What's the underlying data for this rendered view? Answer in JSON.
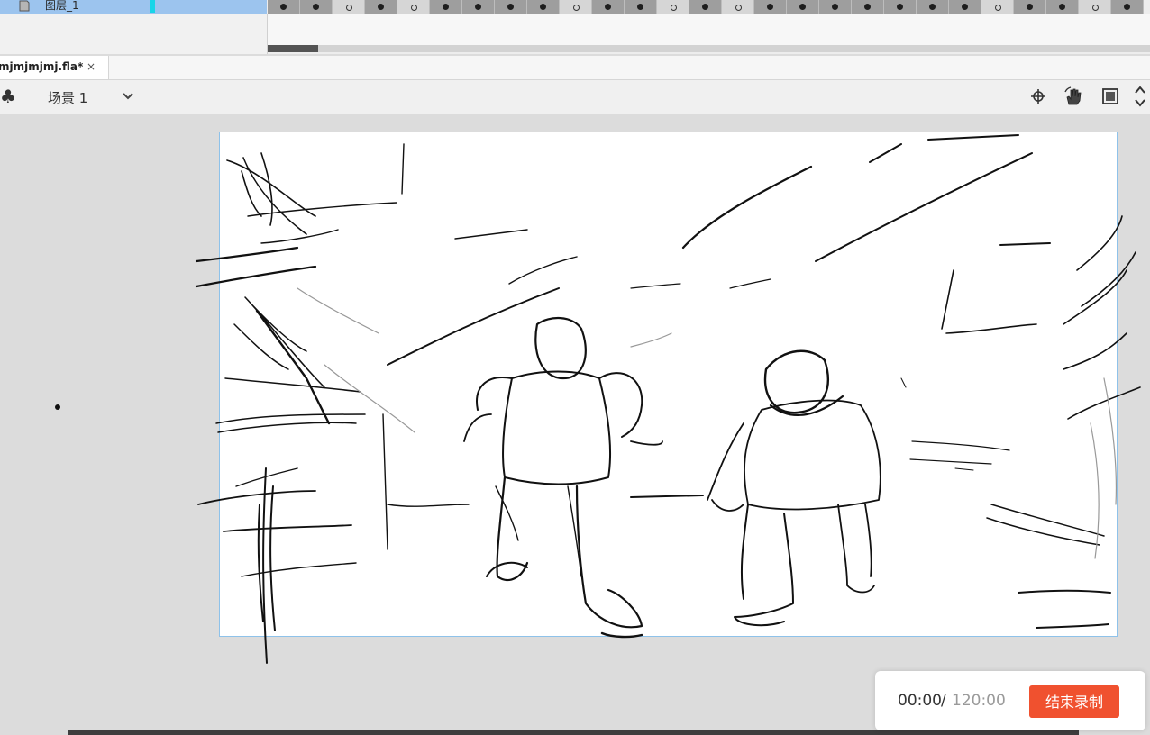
{
  "timeline": {
    "layer_name": "图层_1",
    "frames": [
      "key",
      "key",
      "blank",
      "key",
      "blank",
      "key",
      "key",
      "key",
      "key",
      "blank",
      "key",
      "key",
      "blank",
      "key",
      "blank",
      "key",
      "key",
      "key",
      "key",
      "key",
      "key",
      "key",
      "blank",
      "key",
      "key",
      "blank",
      "key"
    ]
  },
  "document": {
    "tab_title": "mjmjmjmj.fla*",
    "close_glyph": "×"
  },
  "scene": {
    "label": "场景 1"
  },
  "recording": {
    "elapsed": "00:00",
    "separator": "/",
    "total": "120:00",
    "stop_label": "结束录制"
  },
  "colors": {
    "stop_button": "#f0512f",
    "layer_highlight": "#9cc4ee",
    "stage_border": "#8ec2ea"
  },
  "icons": [
    "layer-icon",
    "club-icon",
    "chevron-down-icon",
    "center-stage-icon",
    "hand-tool-icon",
    "clip-canvas-icon",
    "scroll-up-down-icon",
    "close-icon"
  ]
}
